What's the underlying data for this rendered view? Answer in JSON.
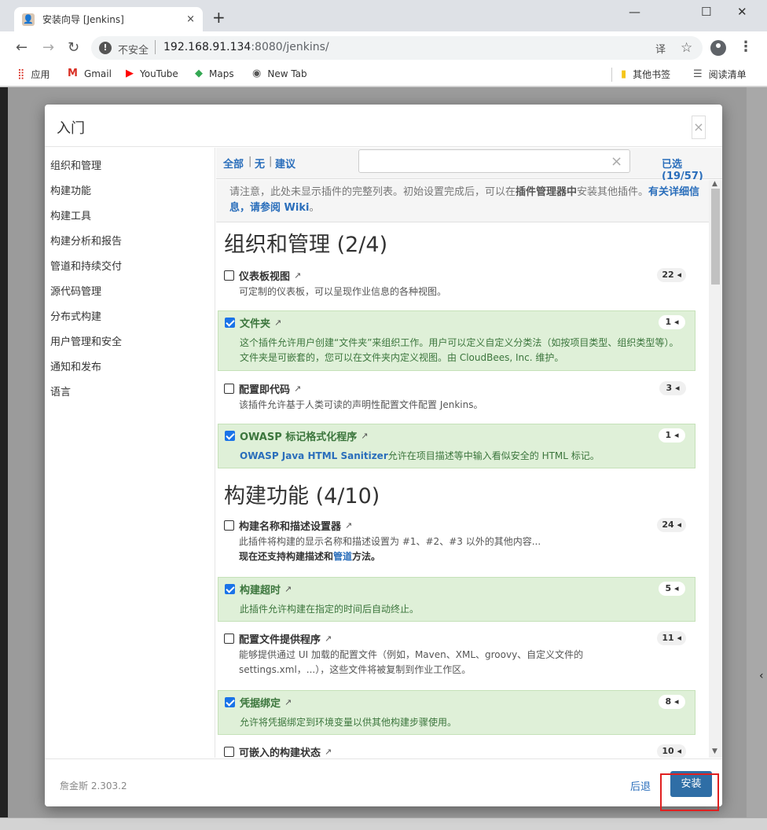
{
  "browser": {
    "tab_title": "安装向导 [Jenkins]",
    "tab_close": "×",
    "new_tab": "+",
    "window_controls": [
      "—",
      "☐",
      "✕"
    ],
    "insecure_label": "不安全",
    "url_host": "192.168.91.134",
    "url_path": ":8080/jenkins/",
    "bookmarks": [
      {
        "label": "应用",
        "icon": "apps-grid-icon"
      },
      {
        "label": "Gmail",
        "icon": "gmail-icon"
      },
      {
        "label": "YouTube",
        "icon": "youtube-icon"
      },
      {
        "label": "Maps",
        "icon": "maps-icon"
      },
      {
        "label": "New Tab",
        "icon": "globe-icon"
      }
    ],
    "bookmarks_right": [
      {
        "label": "其他书签",
        "icon": "folder-icon"
      },
      {
        "label": "阅读清单",
        "icon": "reading-list-icon"
      }
    ]
  },
  "modal": {
    "title": "入门",
    "close": "×",
    "sidebar": [
      "组织和管理",
      "构建功能",
      "构建工具",
      "构建分析和报告",
      "管道和持续交付",
      "源代码管理",
      "分布式构建",
      "用户管理和安全",
      "通知和发布",
      "语言"
    ],
    "filter": {
      "all": "全部",
      "none": "无",
      "suggested": "建议",
      "separator": "|",
      "clear": "×",
      "selected": "已选(19/57)"
    },
    "notice": {
      "text1": "请注意，此处未显示插件的完整列表。初始设置完成后，可以在",
      "bold": "插件管理器中",
      "text2": "安装其他插件。",
      "link": "有关详细信息，请参阅 Wiki",
      "end": "。"
    },
    "categories": [
      {
        "title": "组织和管理 (2/4)"
      },
      {
        "title": "构建功能 (4/10)"
      }
    ],
    "plugins": [
      {
        "name": "仪表板视图",
        "count": "22",
        "checked": false,
        "desc": "可定制的仪表板，可以呈现作业信息的各种视图。"
      },
      {
        "name": "文件夹",
        "count": "1",
        "checked": true,
        "desc": "这个插件允许用户创建“文件夹”来组织工作。用户可以定义自定义分类法（如按项目类型、组织类型等）。文件夹是可嵌套的，您可以在文件夹内定义视图。由 CloudBees, Inc. 维护。"
      },
      {
        "name": "配置即代码",
        "count": "3",
        "checked": false,
        "desc": "该插件允许基于人类可读的声明性配置文件配置 Jenkins。"
      },
      {
        "name": "OWASP 标记格式化程序",
        "count": "1",
        "checked": true,
        "desc_link": "OWASP Java HTML Sanitizer",
        "desc": "允许在项目描述等中输入看似安全的 HTML 标记。"
      },
      {
        "name": "构建名称和描述设置器",
        "count": "24",
        "checked": false,
        "desc": "此插件将构建的显示名称和描述设置为 #1、#2、#3 以外的其他内容...",
        "desc2_a": "现在还支持构建描述和",
        "desc2_link": "管道",
        "desc2_b": "方法。"
      },
      {
        "name": "构建超时",
        "count": "5",
        "checked": true,
        "desc": "此插件允许构建在指定的时间后自动终止。"
      },
      {
        "name": "配置文件提供程序",
        "count": "11",
        "checked": false,
        "desc": "能够提供通过 UI 加载的配置文件（例如，Maven、XML、groovy、自定义文件的 settings.xml，...），这些文件将被复制到作业工作区。"
      },
      {
        "name": "凭据绑定",
        "count": "8",
        "checked": true,
        "desc": "允许将凭据绑定到环境变量以供其他构建步骤使用。"
      },
      {
        "name": "可嵌入的构建状态",
        "count": "10",
        "checked": false,
        "desc": ""
      }
    ],
    "ext_icon": "↗",
    "badge_arrow": "◂",
    "footer": {
      "version": "詹金斯 2.303.2",
      "back": "后退",
      "install": "安装"
    }
  }
}
